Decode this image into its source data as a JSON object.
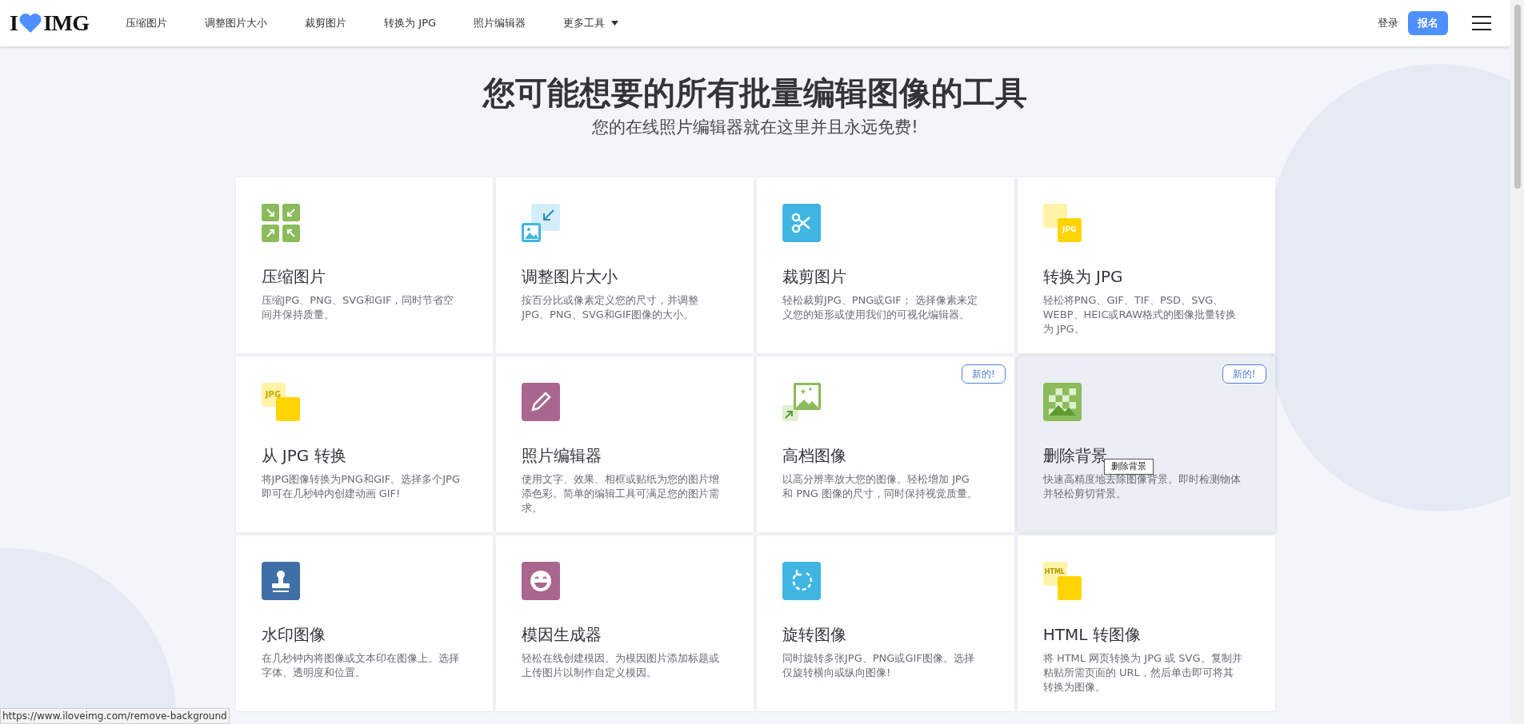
{
  "header": {
    "logo": {
      "left": "I",
      "right": "IMG"
    },
    "nav": [
      {
        "label": "压缩图片",
        "kind": "link"
      },
      {
        "label": "调整图片大小",
        "kind": "link"
      },
      {
        "label": "裁剪图片",
        "kind": "link"
      },
      {
        "label": "转换为 JPG",
        "kind": "link"
      },
      {
        "label": "照片编辑器",
        "kind": "link"
      },
      {
        "label": "更多工具",
        "kind": "dropdown"
      }
    ],
    "login": "登录",
    "signup": "报名"
  },
  "hero": {
    "title": "您可能想要的所有批量编辑图像的工具",
    "subtitle": "您的在线照片编辑器就在这里并且永远免费!"
  },
  "tools": [
    {
      "kind": "compress",
      "title": "压缩图片",
      "description": "压缩JPG、PNG、SVG和GIF，同时节省空间并保持质量。",
      "hovered": false
    },
    {
      "kind": "resize",
      "title": "调整图片大小",
      "description": "按百分比或像素定义您的尺寸，并调整JPG、PNG、SVG和GIF图像的大小。",
      "hovered": false
    },
    {
      "kind": "crop",
      "title": "裁剪图片",
      "description": "轻松裁剪JPG、PNG或GIF； 选择像素来定义您的矩形或使用我们的可视化编辑器。",
      "hovered": false
    },
    {
      "kind": "convert_to",
      "icon_label": "JPG",
      "title": "转换为 JPG",
      "description": "轻松将PNG、GIF、TIF、PSD、SVG、WEBP、HEIC或RAW格式的图像批量转换为 JPG。",
      "hovered": false
    },
    {
      "kind": "convert_from",
      "icon_label": "JPG",
      "title": "从 JPG 转换",
      "description": "将JPG图像转换为PNG和GIF。选择多个JPG即可在几秒钟内创建动画 GIF!",
      "hovered": false
    },
    {
      "kind": "edit",
      "title": "照片编辑器",
      "description": "使用文字、效果、相框或贴纸为您的图片增添色彩。简单的编辑工具可满足您的图片需求。",
      "hovered": false
    },
    {
      "kind": "upscale",
      "title": "高档图像",
      "description": "以高分辨率放大您的图像。轻松增加 JPG 和 PNG 图像的尺寸，同时保持视觉质量。",
      "badge": "新的!",
      "hovered": false
    },
    {
      "kind": "remove_bg",
      "title": "删除背景",
      "description": "快速高精度地去除图像背景。即时检测物体并轻松剪切背景。",
      "badge": "新的!",
      "hovered": true,
      "tooltip": "删除背景"
    },
    {
      "kind": "watermark",
      "title": "水印图像",
      "description": "在几秒钟内将图像或文本印在图像上。选择字体、透明度和位置。",
      "hovered": false
    },
    {
      "kind": "meme",
      "title": "模因生成器",
      "description": "轻松在线创建模因。为模因图片添加标题或上传图片以制作自定义模因。",
      "hovered": false
    },
    {
      "kind": "rotate",
      "title": "旋转图像",
      "description": "同时旋转多张JPG、PNG或GIF图像。选择仅旋转横向或纵向图像!",
      "hovered": false
    },
    {
      "kind": "convert_to",
      "icon_label": "HTML",
      "title": "HTML 转图像",
      "description": "将 HTML 网页转换为 JPG 或 SVG。复制并粘贴所需页面的 URL，然后单击即可将其转换为图像。",
      "hovered": false
    }
  ],
  "status_bar": {
    "url": "https://www.iloveimg.com/remove-background"
  }
}
